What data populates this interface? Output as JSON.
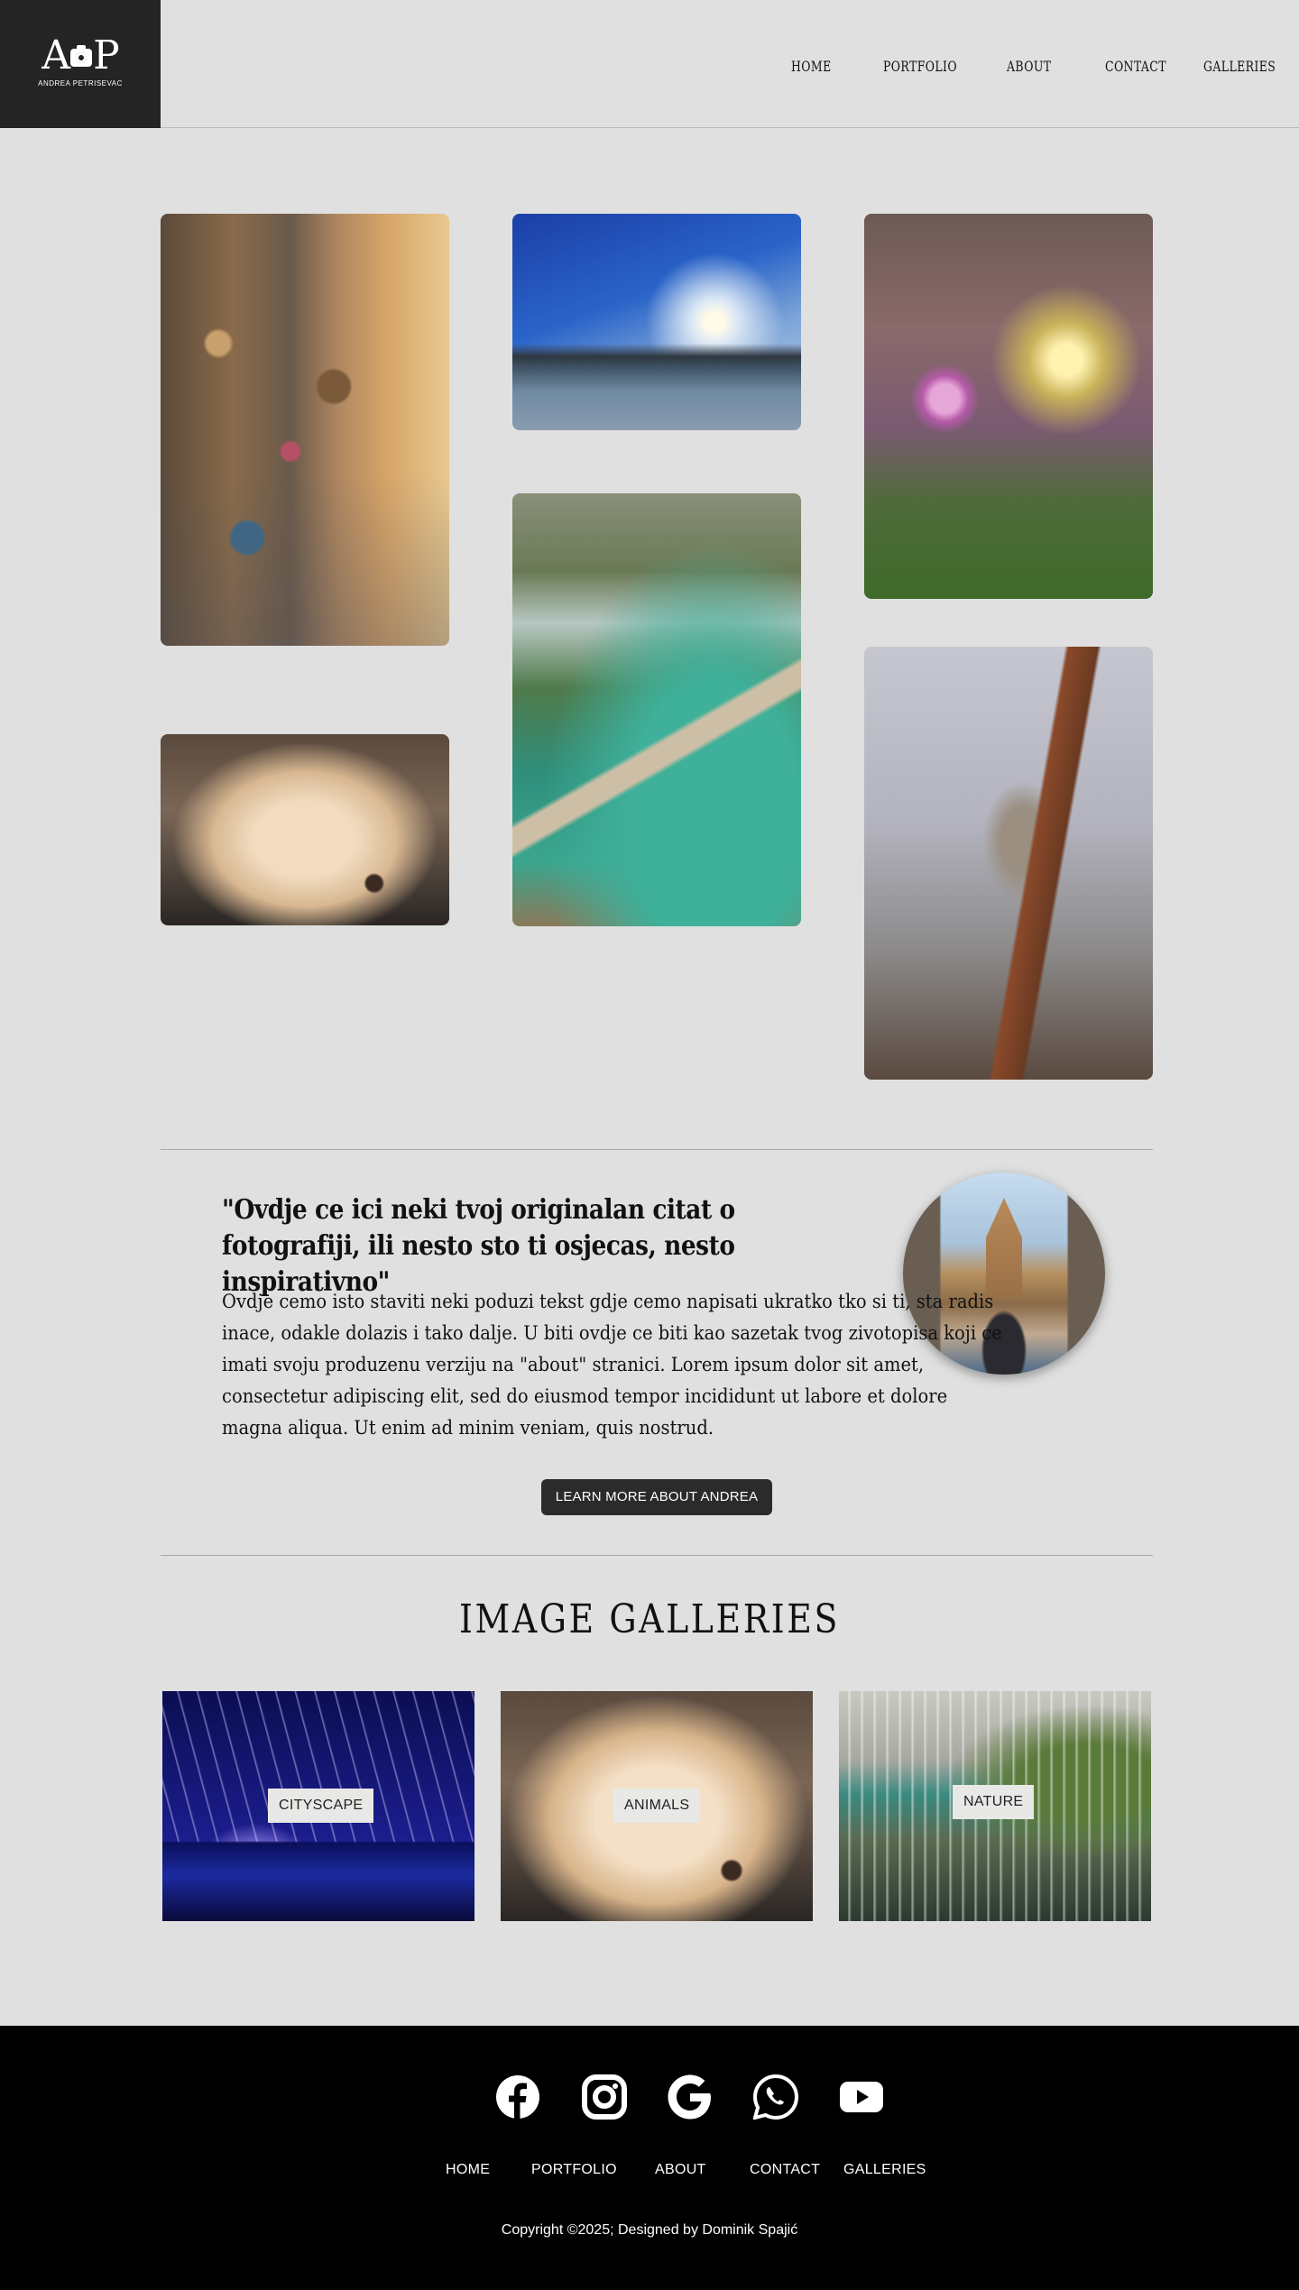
{
  "brand": {
    "logo_mark": "A",
    "logo_mark_end": "P",
    "logo_sub": "ANDREA PETRISEVAC"
  },
  "nav": [
    {
      "label": "HOME"
    },
    {
      "label": "PORTFOLIO"
    },
    {
      "label": "ABOUT"
    },
    {
      "label": "CONTACT"
    },
    {
      "label": "GALLERIES"
    }
  ],
  "about": {
    "quote": "\"Ovdje ce ici neki tvoj originalan citat o fotografiji, ili nesto sto ti osjecas, nesto inspirativno\"",
    "text": "Ovdje cemo isto staviti neki poduzi tekst gdje cemo napisati ukratko tko si ti, sta radis inace, odakle dolazis i tako dalje. U biti ovdje ce biti kao sazetak tvog zivotopisa koji ce imati svoju produzenu verziju na \"about\" stranici. Lorem ipsum dolor sit amet, consectetur adipiscing elit, sed do eiusmod tempor incididunt ut labore et dolore magna aliqua. Ut enim ad minim veniam, quis nostrud.",
    "button_label": "LEARN MORE ABOUT ANDREA"
  },
  "galleries": {
    "title": "IMAGE GALLERIES",
    "items": [
      {
        "label": "CITYSCAPE"
      },
      {
        "label": "ANIMALS"
      },
      {
        "label": "NATURE"
      }
    ]
  },
  "footer": {
    "social_icons": [
      "facebook-icon",
      "instagram-icon",
      "google-icon",
      "whatsapp-icon",
      "youtube-icon"
    ],
    "nav": [
      {
        "label": "HOME"
      },
      {
        "label": "PORTFOLIO"
      },
      {
        "label": "ABOUT"
      },
      {
        "label": "CONTACT"
      },
      {
        "label": "GALLERIES"
      }
    ],
    "copyright": "Copyright ©2025; Designed by Dominik Spajić"
  },
  "colors": {
    "page_bg": "#dfe0df",
    "logo_bg": "#242424",
    "button_bg": "#2b2b2b",
    "footer_bg": "#000000"
  }
}
